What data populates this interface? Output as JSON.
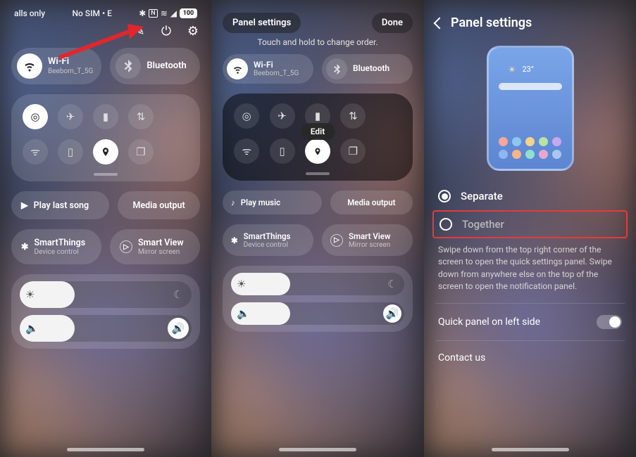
{
  "statusbar": {
    "left": "alls only",
    "carrier": "No SIM • E",
    "battery": "100"
  },
  "panel1": {
    "wifi_label": "Wi-Fi",
    "wifi_sub": "Beebom_T_5G",
    "bt_label": "Bluetooth",
    "play_last": "Play last song",
    "media_output": "Media output",
    "smartthings": "SmartThings",
    "smartthings_sub": "Device control",
    "smartview": "Smart View",
    "smartview_sub": "Mirror screen"
  },
  "panel2": {
    "panel_settings": "Panel settings",
    "done": "Done",
    "hint": "Touch and hold to change order.",
    "wifi_label": "Wi-Fi",
    "wifi_sub": "Beebom_T_5G",
    "bt_label": "Bluetooth",
    "edit": "Edit",
    "play_music": "Play music",
    "media_output": "Media output",
    "smartthings": "SmartThings",
    "smartthings_sub": "Device control",
    "smartview": "Smart View",
    "smartview_sub": "Mirror screen"
  },
  "panel3": {
    "title": "Panel settings",
    "preview_temp": "23°",
    "separate": "Separate",
    "together": "Together",
    "desc": "Swipe down from the top right corner of the screen to open the quick settings panel. Swipe down from anywhere else on the top of the screen to open the notification panel.",
    "quick_left": "Quick panel on left side",
    "contact": "Contact us"
  }
}
